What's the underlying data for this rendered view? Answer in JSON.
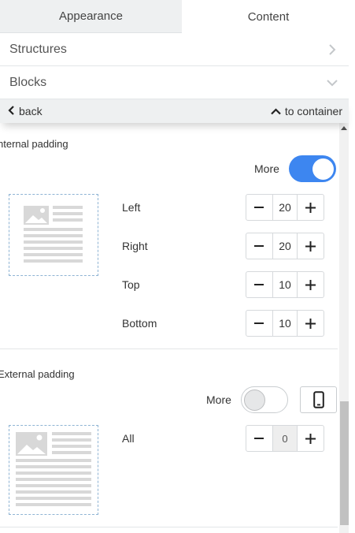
{
  "tabs": [
    {
      "label": "Appearance",
      "active": false
    },
    {
      "label": "Content",
      "active": true
    }
  ],
  "accordion": {
    "structures": "Structures",
    "blocks": "Blocks"
  },
  "nav": {
    "back": "back",
    "to_container": "to container"
  },
  "internal_padding": {
    "title": "nternal padding",
    "more_label": "More",
    "more_enabled": true,
    "rows": [
      {
        "label": "Left",
        "value": "20"
      },
      {
        "label": "Right",
        "value": "20"
      },
      {
        "label": "Top",
        "value": "10"
      },
      {
        "label": "Bottom",
        "value": "10"
      }
    ]
  },
  "external_padding": {
    "title": "External padding",
    "more_label": "More",
    "more_enabled": false,
    "rows": [
      {
        "label": "All",
        "value": "0",
        "disabled": true
      }
    ]
  },
  "icons": {
    "chevron_right": "chevron-right-icon",
    "chevron_down": "chevron-down-icon",
    "chevron_left": "chevron-left-icon",
    "chevron_up": "chevron-up-icon",
    "minus": "minus-icon",
    "plus": "plus-icon",
    "mobile": "mobile-device-icon",
    "image": "image-placeholder-icon"
  },
  "colors": {
    "accent": "#3d86f0",
    "tab_inactive_bg": "#eef0f1",
    "preview_border": "#8fb4d4"
  }
}
